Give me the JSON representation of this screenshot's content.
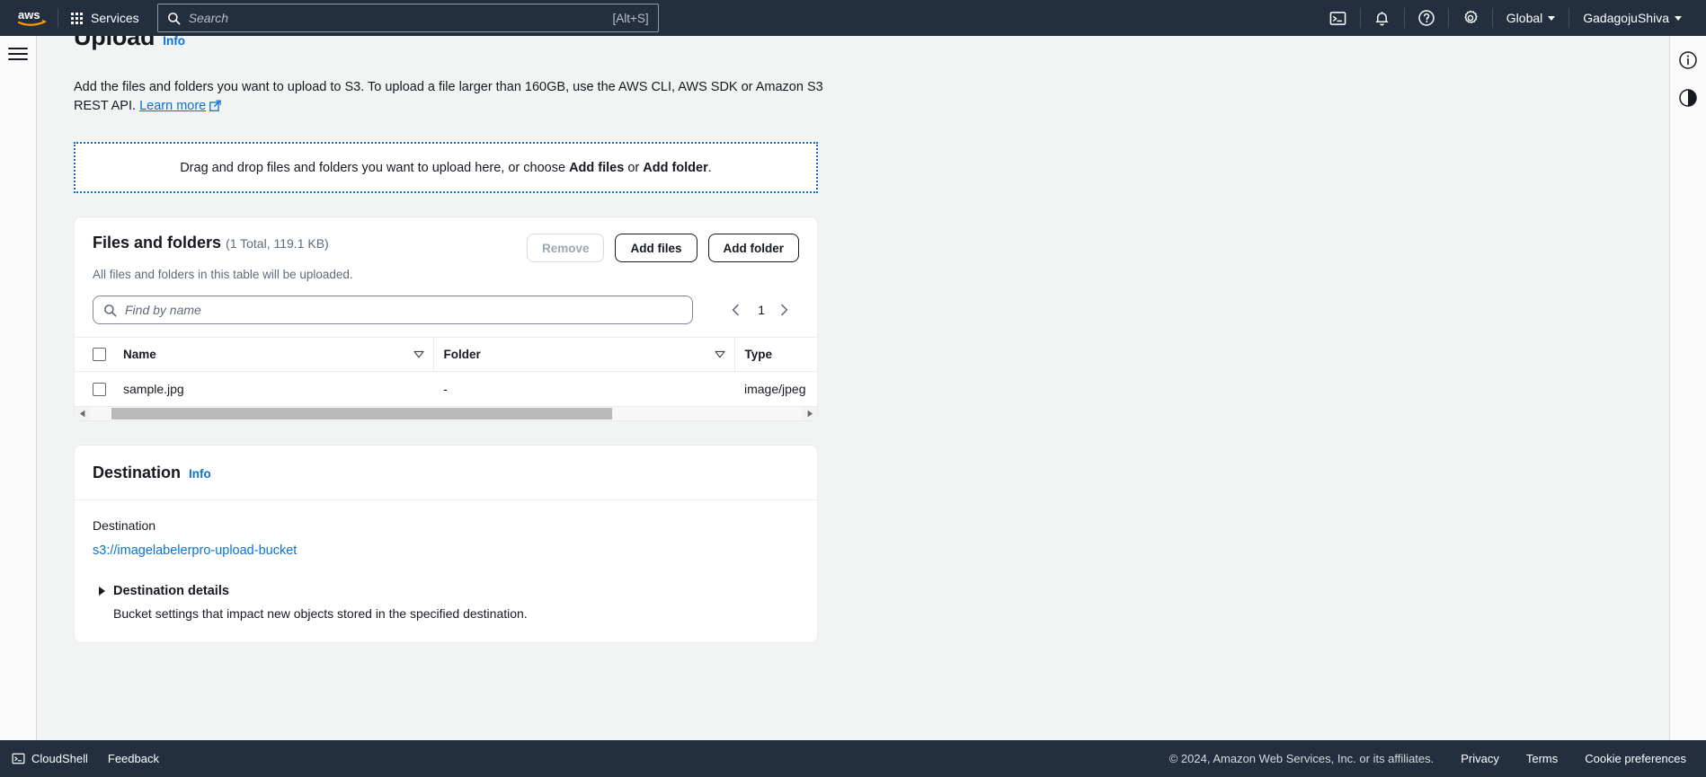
{
  "topnav": {
    "logo": "aws-logo",
    "services_label": "Services",
    "search_placeholder": "Search",
    "search_shortcut": "[Alt+S]",
    "cloudshell_icon": "cloudshell-icon",
    "notifications_icon": "bell-icon",
    "help_icon": "help-circle-icon",
    "settings_icon": "gear-icon",
    "region_label": "Global",
    "account_label": "GadagojuShiva"
  },
  "rails": {
    "menu_icon": "hamburger-menu-icon",
    "info_panel_icon": "info-circle-icon",
    "shortcuts_icon": "contrast-circle-icon"
  },
  "page": {
    "title": "Upload",
    "info_label": "Info",
    "intro_text_1": "Add the files and folders you want to upload to S3. To upload a file larger than 160GB, use the AWS CLI, AWS SDK or Amazon S3 REST API.",
    "learn_more": "Learn more",
    "external_icon": "external-link-icon"
  },
  "dropzone": {
    "text_before": "Drag and drop files and folders you want to upload here, or choose ",
    "bold_1": "Add files",
    "text_middle": " or ",
    "bold_2": "Add folder",
    "text_after": "."
  },
  "files_card": {
    "title": "Files and folders",
    "count": "(1 Total, 119.1 KB)",
    "subtitle": "All files and folders in this table will be uploaded.",
    "remove_label": "Remove",
    "add_files_label": "Add files",
    "add_folder_label": "Add folder",
    "search_placeholder": "Find by name",
    "search_icon": "search-icon",
    "prev_icon": "chevron-left-icon",
    "page_number": "1",
    "next_icon": "chevron-right-icon",
    "columns": [
      "Name",
      "Folder",
      "Type"
    ],
    "rows": [
      {
        "name": "sample.jpg",
        "folder": "-",
        "type": "image/jpeg"
      }
    ]
  },
  "destination": {
    "title": "Destination",
    "info_label": "Info",
    "field_label": "Destination",
    "bucket_uri": "s3://imagelabelerpro-upload-bucket",
    "details_title": "Destination details",
    "details_sub": "Bucket settings that impact new objects stored in the specified destination."
  },
  "footer": {
    "cloudshell_label": "CloudShell",
    "cloudshell_icon": "cloudshell-icon",
    "feedback_label": "Feedback",
    "copyright": "© 2024, Amazon Web Services, Inc. or its affiliates.",
    "privacy_label": "Privacy",
    "terms_label": "Terms",
    "cookie_label": "Cookie preferences"
  },
  "colors": {
    "nav_bg": "#232f3e",
    "link_blue": "#0972d3",
    "page_bg": "#f2f3f3"
  }
}
